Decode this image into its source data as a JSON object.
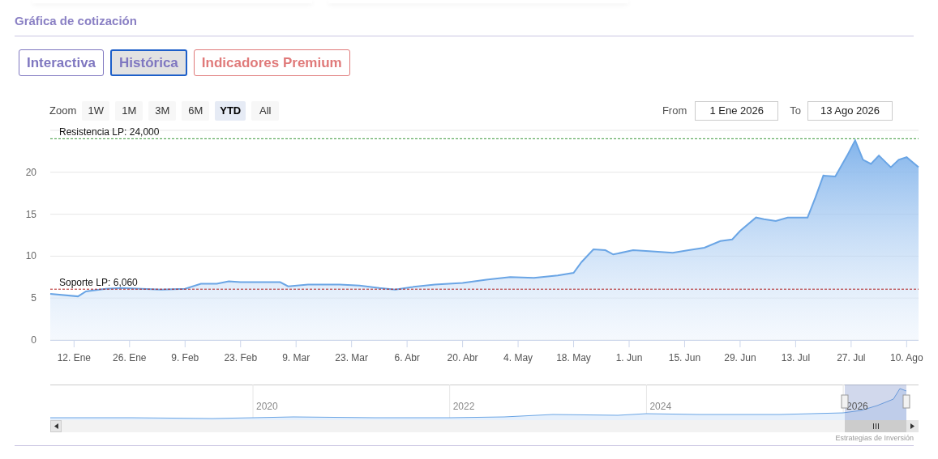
{
  "section_title": "Gráfica de cotización",
  "tabs": [
    {
      "label": "Interactiva",
      "selected": false,
      "color": "#7f77c0"
    },
    {
      "label": "Histórica",
      "selected": true,
      "color": "#7f77c0"
    },
    {
      "label": "Indicadores Premium",
      "selected": false,
      "color": "#e07a7a"
    }
  ],
  "zoom": {
    "label": "Zoom",
    "buttons": [
      {
        "label": "1W",
        "selected": false
      },
      {
        "label": "1M",
        "selected": false
      },
      {
        "label": "3M",
        "selected": false
      },
      {
        "label": "6M",
        "selected": false
      },
      {
        "label": "YTD",
        "selected": true
      },
      {
        "label": "All",
        "selected": false
      }
    ]
  },
  "range": {
    "from_label": "From",
    "from_value": "1 Ene 2026",
    "to_label": "To",
    "to_value": "13 Ago 2026"
  },
  "chart": {
    "chart_data": {
      "type": "area",
      "grid": true,
      "xlim": [
        "2026-01-06",
        "2026-08-13"
      ],
      "ylim": [
        0,
        25
      ],
      "yticks": [
        0,
        5,
        10,
        15,
        20
      ],
      "xticks": [
        {
          "value": "2026-01-12",
          "label": "12. Ene"
        },
        {
          "value": "2026-01-26",
          "label": "26. Ene"
        },
        {
          "value": "2026-02-09",
          "label": "9. Feb"
        },
        {
          "value": "2026-02-23",
          "label": "23. Feb"
        },
        {
          "value": "2026-03-09",
          "label": "9. Mar"
        },
        {
          "value": "2026-03-23",
          "label": "23. Mar"
        },
        {
          "value": "2026-04-06",
          "label": "6. Abr"
        },
        {
          "value": "2026-04-20",
          "label": "20. Abr"
        },
        {
          "value": "2026-05-04",
          "label": "4. May"
        },
        {
          "value": "2026-05-18",
          "label": "18. May"
        },
        {
          "value": "2026-06-01",
          "label": "1. Jun"
        },
        {
          "value": "2026-06-15",
          "label": "15. Jun"
        },
        {
          "value": "2026-06-29",
          "label": "29. Jun"
        },
        {
          "value": "2026-07-13",
          "label": "13. Jul"
        },
        {
          "value": "2026-07-27",
          "label": "27. Jul"
        },
        {
          "value": "2026-08-10",
          "label": "10. Ago"
        }
      ],
      "x": [
        "2026-01-06",
        "2026-01-13",
        "2026-01-15",
        "2026-01-20",
        "2026-01-24",
        "2026-01-29",
        "2026-02-03",
        "2026-02-09",
        "2026-02-13",
        "2026-02-17",
        "2026-02-20",
        "2026-02-23",
        "2026-02-27",
        "2026-03-05",
        "2026-03-07",
        "2026-03-12",
        "2026-03-16",
        "2026-03-20",
        "2026-03-25",
        "2026-03-30",
        "2026-04-03",
        "2026-04-07",
        "2026-04-13",
        "2026-04-20",
        "2026-04-26",
        "2026-05-02",
        "2026-05-08",
        "2026-05-14",
        "2026-05-18",
        "2026-05-20",
        "2026-05-23",
        "2026-05-26",
        "2026-05-28",
        "2026-06-02",
        "2026-06-06",
        "2026-06-12",
        "2026-06-16",
        "2026-06-20",
        "2026-06-24",
        "2026-06-27",
        "2026-06-29",
        "2026-07-03",
        "2026-07-05",
        "2026-07-08",
        "2026-07-11",
        "2026-07-16",
        "2026-07-18",
        "2026-07-20",
        "2026-07-23",
        "2026-07-26",
        "2026-07-28",
        "2026-07-30",
        "2026-08-01",
        "2026-08-03",
        "2026-08-06",
        "2026-08-08",
        "2026-08-10",
        "2026-08-13"
      ],
      "series": [
        {
          "color": "#6aa5e5",
          "values": [
            5.5,
            5.2,
            5.8,
            6.1,
            6.2,
            6.1,
            6.0,
            6.1,
            6.7,
            6.7,
            7.0,
            6.9,
            6.9,
            6.9,
            6.4,
            6.6,
            6.6,
            6.6,
            6.5,
            6.2,
            6.0,
            6.3,
            6.6,
            6.8,
            7.2,
            7.5,
            7.4,
            7.7,
            8.0,
            9.3,
            10.8,
            10.7,
            10.2,
            10.7,
            10.6,
            10.4,
            10.7,
            11.0,
            11.8,
            12.0,
            13.0,
            14.6,
            14.4,
            14.2,
            14.6,
            14.6,
            17.0,
            19.6,
            19.5,
            22.0,
            23.8,
            21.5,
            21.0,
            22.0,
            20.6,
            21.5,
            21.8,
            20.6
          ]
        }
      ],
      "ref_lines": [
        {
          "axis": "y",
          "value": 24,
          "label": "Resistencia LP: 24,000",
          "color": "#3a9a3a"
        },
        {
          "axis": "y",
          "value": 6.06,
          "label": "Soporte LP: 6,060",
          "color": "#b01c1c"
        }
      ]
    }
  },
  "navigator": {
    "years": [
      "2020",
      "2022",
      "2024",
      "2026"
    ]
  },
  "credits": "Estrategias de Inversión"
}
